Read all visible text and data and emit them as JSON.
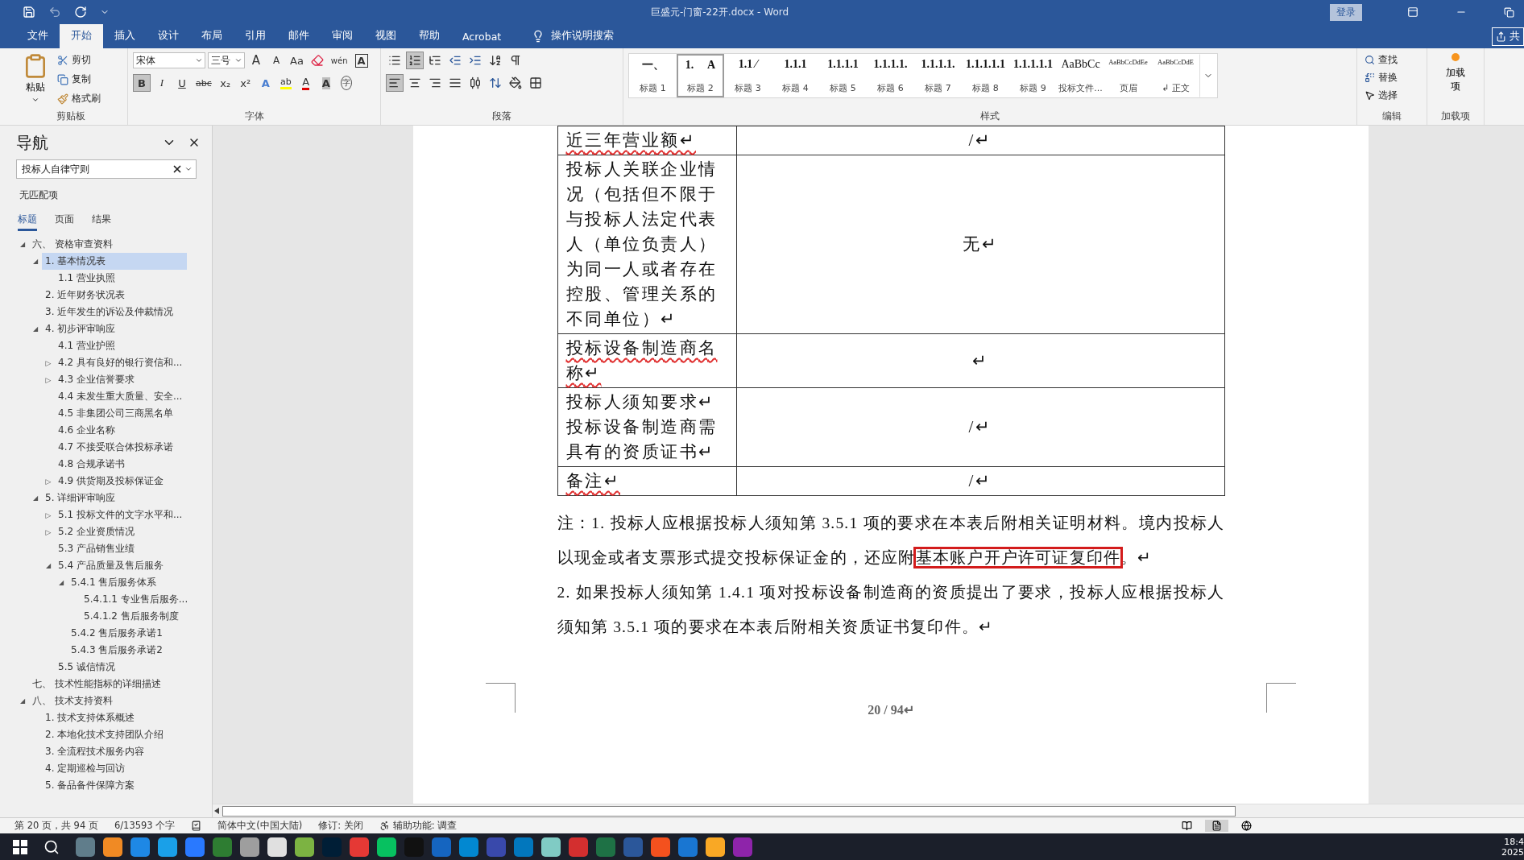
{
  "window": {
    "title": "巨盛元-门窗-22开.docx  -  Word",
    "login": "登录",
    "share": "共"
  },
  "tabs": [
    {
      "label": "文件",
      "selected": false
    },
    {
      "label": "开始",
      "selected": true
    },
    {
      "label": "插入",
      "selected": false
    },
    {
      "label": "设计",
      "selected": false
    },
    {
      "label": "布局",
      "selected": false
    },
    {
      "label": "引用",
      "selected": false
    },
    {
      "label": "邮件",
      "selected": false
    },
    {
      "label": "审阅",
      "selected": false
    },
    {
      "label": "视图",
      "selected": false
    },
    {
      "label": "帮助",
      "selected": false
    },
    {
      "label": "Acrobat",
      "selected": false
    }
  ],
  "tell_me": "操作说明搜索",
  "clipboard": {
    "label": "剪贴板",
    "paste": "粘贴",
    "cut": "剪切",
    "copy": "复制",
    "format_painter": "格式刷"
  },
  "font": {
    "label": "字体",
    "name": "宋体",
    "size": "三号",
    "row1": [
      {
        "kind": "grow",
        "label": "A"
      },
      {
        "kind": "shrink",
        "label": "A"
      },
      {
        "kind": "case",
        "label": "Aa"
      },
      {
        "kind": "clear"
      },
      {
        "kind": "phonetic",
        "label": "wén"
      },
      {
        "kind": "border",
        "label": "A"
      }
    ],
    "row2": [
      {
        "kind": "bold",
        "label": "B",
        "selected": true
      },
      {
        "kind": "italic",
        "label": "I",
        "selected": false
      },
      {
        "kind": "underline",
        "label": "U",
        "selected": false
      },
      {
        "kind": "strike",
        "label": "abc",
        "selected": false
      },
      {
        "kind": "sub",
        "label": "x₂",
        "selected": false
      },
      {
        "kind": "sup",
        "label": "x²",
        "selected": false
      },
      {
        "kind": "effects",
        "label": "A",
        "selected": false
      },
      {
        "kind": "highlight",
        "label": "ab",
        "selected": false
      },
      {
        "kind": "color",
        "label": "A",
        "selected": false
      },
      {
        "kind": "shading",
        "label": "A",
        "selected": false
      },
      {
        "kind": "enclose",
        "label": "字",
        "selected": false
      }
    ]
  },
  "paragraph": {
    "label": "段落",
    "bullets_selected": false,
    "numbering_selected": true,
    "align": [
      {
        "kind": "left",
        "selected": true
      },
      {
        "kind": "center",
        "selected": false
      },
      {
        "kind": "right",
        "selected": false
      },
      {
        "kind": "justify",
        "selected": false
      },
      {
        "kind": "distributed",
        "selected": false
      }
    ]
  },
  "styles": {
    "label": "样式",
    "items": [
      {
        "preview": "一、",
        "name": "标题 1",
        "selected": false
      },
      {
        "preview": "1.　 A",
        "name": "标题 2",
        "selected": true
      },
      {
        "preview": "1.1 ⁄",
        "name": "标题 3",
        "selected": false
      },
      {
        "preview": "1.1.1",
        "name": "标题 4",
        "selected": false
      },
      {
        "preview": "1.1.1.1",
        "name": "标题 5",
        "selected": false
      },
      {
        "preview": "1.1.1.1.",
        "name": "标题 6",
        "selected": false
      },
      {
        "preview": "1.1.1.1.",
        "name": "标题 7",
        "selected": false
      },
      {
        "preview": "1.1.1.1.1",
        "name": "标题 8",
        "selected": false
      },
      {
        "preview": "1.1.1.1.1",
        "name": "标题 9",
        "selected": false
      },
      {
        "preview": "AaBbCc",
        "name": "投标文件...",
        "selected": false
      },
      {
        "preview": "AaBbCcDdEe",
        "name": "页眉",
        "selected": false
      },
      {
        "preview": "AaBbCcDdE",
        "name": "↲ 正文",
        "selected": false
      }
    ]
  },
  "editing": {
    "label": "编辑",
    "find": "查找",
    "replace": "替换",
    "select": "选择"
  },
  "addins": {
    "label": "加载项",
    "button": "加载项"
  },
  "navigation": {
    "title": "导航",
    "search": "投标人自律守则",
    "result": "无匹配项",
    "tabs": [
      {
        "label": "标题",
        "selected": true
      },
      {
        "label": "页面",
        "selected": false
      },
      {
        "label": "结果",
        "selected": false
      }
    ],
    "tree": [
      {
        "label": "六、 资格审查资料",
        "toggle": "◢",
        "selected": false,
        "children": [
          {
            "label": "1. 基本情况表",
            "toggle": "◢",
            "selected": true,
            "children": [
              {
                "label": "1.1 营业执照",
                "selected": false
              }
            ]
          },
          {
            "label": "2. 近年财务状况表",
            "selected": false
          },
          {
            "label": "3. 近年发生的诉讼及仲裁情况",
            "selected": false
          },
          {
            "label": "4. 初步评审响应",
            "toggle": "◢",
            "selected": false,
            "children": [
              {
                "label": "4.1 营业护照",
                "selected": false
              },
              {
                "label": "4.2 具有良好的银行资信和...",
                "toggle": "▷",
                "selected": false
              },
              {
                "label": "4.3 企业信誉要求",
                "toggle": "▷",
                "selected": false
              },
              {
                "label": "4.4 未发生重大质量、安全...",
                "selected": false
              },
              {
                "label": "4.5 非集团公司三商黑名单",
                "selected": false
              },
              {
                "label": "4.6 企业名称",
                "selected": false
              },
              {
                "label": "4.7 不接受联合体投标承诺",
                "selected": false
              },
              {
                "label": "4.8 合规承诺书",
                "selected": false
              },
              {
                "label": "4.9 供货期及投标保证金",
                "toggle": "▷",
                "selected": false
              }
            ]
          },
          {
            "label": "5. 详细评审响应",
            "toggle": "◢",
            "selected": false,
            "children": [
              {
                "label": "5.1 投标文件的文字水平和...",
                "toggle": "▷",
                "selected": false
              },
              {
                "label": "5.2 企业资质情况",
                "toggle": "▷",
                "selected": false
              },
              {
                "label": "5.3 产品销售业绩",
                "selected": false
              },
              {
                "label": "5.4 产品质量及售后服务",
                "toggle": "◢",
                "selected": false,
                "children": [
                  {
                    "label": "5.4.1 售后服务体系",
                    "toggle": "◢",
                    "selected": false,
                    "children": [
                      {
                        "label": "5.4.1.1 专业售后服务...",
                        "selected": false
                      },
                      {
                        "label": "5.4.1.2 售后服务制度",
                        "selected": false
                      }
                    ]
                  },
                  {
                    "label": "5.4.2 售后服务承诺1",
                    "selected": false
                  },
                  {
                    "label": "5.4.3 售后服务承诺2",
                    "selected": false
                  }
                ]
              },
              {
                "label": "5.5 诚信情况",
                "selected": false
              }
            ]
          }
        ]
      },
      {
        "label": "七、 技术性能指标的详细描述",
        "selected": false
      },
      {
        "label": "八、 技术支持资料",
        "toggle": "◢",
        "selected": false,
        "children": [
          {
            "label": "1. 技术支持体系概述",
            "selected": false
          },
          {
            "label": "2. 本地化技术支持团队介绍",
            "selected": false
          },
          {
            "label": "3. 全流程技术服务内容",
            "selected": false
          },
          {
            "label": "4. 定期巡检与回访",
            "selected": false
          },
          {
            "label": "5. 备品备件保障方案",
            "selected": false
          }
        ]
      }
    ]
  },
  "table": {
    "rows": [
      {
        "label": "近三年营业额↵",
        "value": "/↵",
        "flagged": true
      },
      {
        "label": "投标人关联企业情况（包括但不限于与投标人法定代表人（单位负责人）为同一人或者存在控股、管理关系的不同单位）↵",
        "value": "无↵",
        "flagged": false
      },
      {
        "label": "投标设备制造商名称↵",
        "value": "↵",
        "flagged": true
      },
      {
        "label": "投标人须知要求↵\n投标设备制造商需具有的资质证书↵",
        "value": "/↵",
        "flagged": false
      },
      {
        "label": "备注↵",
        "value": "/↵",
        "flagged": true
      }
    ]
  },
  "notes": [
    {
      "segments": [
        {
          "text": "注：1.  投标人应根据投标人须知第 3.5.1 项的要求在本表后附相关证明材料。境内投标人以现金或者支票形式提交投标保证金的，还应附",
          "boxed": false
        },
        {
          "text": "基本账户开户许可证复印件",
          "boxed": true
        },
        {
          "text": "。↵",
          "boxed": false
        }
      ]
    },
    {
      "segments": [
        {
          "text": "2.  如果投标人须知第 1.4.1 项对投标设备制造商的资质提出了要求，投标人应根据投标人须知第 3.5.1 项的要求在本表后附相关资质证书复印件。↵",
          "boxed": false
        }
      ]
    }
  ],
  "page_number": "20  /  94↵",
  "status_bar": {
    "page": "第 20 页，共 94 页",
    "words": "6/13593 个字",
    "language": "简体中文(中国大陆)",
    "track": "修订: 关闭",
    "accessibility": "辅助功能: 调查",
    "views": [
      {
        "kind": "read",
        "selected": false
      },
      {
        "kind": "print",
        "selected": true
      },
      {
        "kind": "web",
        "selected": false
      }
    ]
  },
  "taskbar": {
    "apps": [
      {
        "color": "#607d8b"
      },
      {
        "color": "#f08a24"
      },
      {
        "color": "#1e88e5"
      },
      {
        "color": "#1aa0e8"
      },
      {
        "color": "#2979ff"
      },
      {
        "color": "#2e7d32"
      },
      {
        "color": "#9e9e9e"
      },
      {
        "color": "#e0e0e0"
      },
      {
        "color": "#7cb342"
      },
      {
        "color": "#001e36"
      },
      {
        "color": "#e53935"
      },
      {
        "color": "#07c160"
      },
      {
        "color": "#111111"
      },
      {
        "color": "#1565c0"
      },
      {
        "color": "#0288d1"
      },
      {
        "color": "#3949ab"
      },
      {
        "color": "#0277bd"
      },
      {
        "color": "#80cbc4"
      },
      {
        "color": "#d32f2f"
      },
      {
        "color": "#1e7145"
      },
      {
        "color": "#2b579a"
      },
      {
        "color": "#f4511e"
      },
      {
        "color": "#1976d2"
      },
      {
        "color": "#f9a825"
      },
      {
        "color": "#8e24aa"
      }
    ],
    "time": "18:4",
    "date": "2025"
  }
}
